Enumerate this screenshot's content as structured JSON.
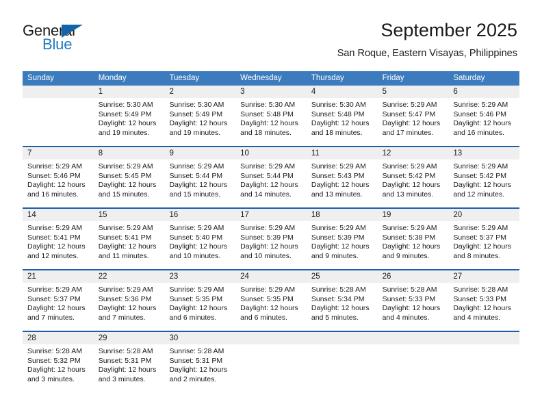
{
  "logo": {
    "text_top": "General",
    "text_bottom": "Blue",
    "accent_color": "#1f78c1",
    "triangle_color": "#1263a8"
  },
  "header": {
    "title": "September 2025",
    "location": "San Roque, Eastern Visayas, Philippines"
  },
  "theme": {
    "header_blue": "#3c7cbe",
    "divider_blue": "#1c5ea8",
    "daynum_band": "#efefef"
  },
  "weekdays": [
    "Sunday",
    "Monday",
    "Tuesday",
    "Wednesday",
    "Thursday",
    "Friday",
    "Saturday"
  ],
  "weeks": [
    {
      "days": [
        {
          "num": "",
          "sunrise": "",
          "sunset": "",
          "daylight_1": "",
          "daylight_2": ""
        },
        {
          "num": "1",
          "sunrise": "Sunrise: 5:30 AM",
          "sunset": "Sunset: 5:49 PM",
          "daylight_1": "Daylight: 12 hours",
          "daylight_2": "and 19 minutes."
        },
        {
          "num": "2",
          "sunrise": "Sunrise: 5:30 AM",
          "sunset": "Sunset: 5:49 PM",
          "daylight_1": "Daylight: 12 hours",
          "daylight_2": "and 19 minutes."
        },
        {
          "num": "3",
          "sunrise": "Sunrise: 5:30 AM",
          "sunset": "Sunset: 5:48 PM",
          "daylight_1": "Daylight: 12 hours",
          "daylight_2": "and 18 minutes."
        },
        {
          "num": "4",
          "sunrise": "Sunrise: 5:30 AM",
          "sunset": "Sunset: 5:48 PM",
          "daylight_1": "Daylight: 12 hours",
          "daylight_2": "and 18 minutes."
        },
        {
          "num": "5",
          "sunrise": "Sunrise: 5:29 AM",
          "sunset": "Sunset: 5:47 PM",
          "daylight_1": "Daylight: 12 hours",
          "daylight_2": "and 17 minutes."
        },
        {
          "num": "6",
          "sunrise": "Sunrise: 5:29 AM",
          "sunset": "Sunset: 5:46 PM",
          "daylight_1": "Daylight: 12 hours",
          "daylight_2": "and 16 minutes."
        }
      ]
    },
    {
      "days": [
        {
          "num": "7",
          "sunrise": "Sunrise: 5:29 AM",
          "sunset": "Sunset: 5:46 PM",
          "daylight_1": "Daylight: 12 hours",
          "daylight_2": "and 16 minutes."
        },
        {
          "num": "8",
          "sunrise": "Sunrise: 5:29 AM",
          "sunset": "Sunset: 5:45 PM",
          "daylight_1": "Daylight: 12 hours",
          "daylight_2": "and 15 minutes."
        },
        {
          "num": "9",
          "sunrise": "Sunrise: 5:29 AM",
          "sunset": "Sunset: 5:44 PM",
          "daylight_1": "Daylight: 12 hours",
          "daylight_2": "and 15 minutes."
        },
        {
          "num": "10",
          "sunrise": "Sunrise: 5:29 AM",
          "sunset": "Sunset: 5:44 PM",
          "daylight_1": "Daylight: 12 hours",
          "daylight_2": "and 14 minutes."
        },
        {
          "num": "11",
          "sunrise": "Sunrise: 5:29 AM",
          "sunset": "Sunset: 5:43 PM",
          "daylight_1": "Daylight: 12 hours",
          "daylight_2": "and 13 minutes."
        },
        {
          "num": "12",
          "sunrise": "Sunrise: 5:29 AM",
          "sunset": "Sunset: 5:42 PM",
          "daylight_1": "Daylight: 12 hours",
          "daylight_2": "and 13 minutes."
        },
        {
          "num": "13",
          "sunrise": "Sunrise: 5:29 AM",
          "sunset": "Sunset: 5:42 PM",
          "daylight_1": "Daylight: 12 hours",
          "daylight_2": "and 12 minutes."
        }
      ]
    },
    {
      "days": [
        {
          "num": "14",
          "sunrise": "Sunrise: 5:29 AM",
          "sunset": "Sunset: 5:41 PM",
          "daylight_1": "Daylight: 12 hours",
          "daylight_2": "and 12 minutes."
        },
        {
          "num": "15",
          "sunrise": "Sunrise: 5:29 AM",
          "sunset": "Sunset: 5:41 PM",
          "daylight_1": "Daylight: 12 hours",
          "daylight_2": "and 11 minutes."
        },
        {
          "num": "16",
          "sunrise": "Sunrise: 5:29 AM",
          "sunset": "Sunset: 5:40 PM",
          "daylight_1": "Daylight: 12 hours",
          "daylight_2": "and 10 minutes."
        },
        {
          "num": "17",
          "sunrise": "Sunrise: 5:29 AM",
          "sunset": "Sunset: 5:39 PM",
          "daylight_1": "Daylight: 12 hours",
          "daylight_2": "and 10 minutes."
        },
        {
          "num": "18",
          "sunrise": "Sunrise: 5:29 AM",
          "sunset": "Sunset: 5:39 PM",
          "daylight_1": "Daylight: 12 hours",
          "daylight_2": "and 9 minutes."
        },
        {
          "num": "19",
          "sunrise": "Sunrise: 5:29 AM",
          "sunset": "Sunset: 5:38 PM",
          "daylight_1": "Daylight: 12 hours",
          "daylight_2": "and 9 minutes."
        },
        {
          "num": "20",
          "sunrise": "Sunrise: 5:29 AM",
          "sunset": "Sunset: 5:37 PM",
          "daylight_1": "Daylight: 12 hours",
          "daylight_2": "and 8 minutes."
        }
      ]
    },
    {
      "days": [
        {
          "num": "21",
          "sunrise": "Sunrise: 5:29 AM",
          "sunset": "Sunset: 5:37 PM",
          "daylight_1": "Daylight: 12 hours",
          "daylight_2": "and 7 minutes."
        },
        {
          "num": "22",
          "sunrise": "Sunrise: 5:29 AM",
          "sunset": "Sunset: 5:36 PM",
          "daylight_1": "Daylight: 12 hours",
          "daylight_2": "and 7 minutes."
        },
        {
          "num": "23",
          "sunrise": "Sunrise: 5:29 AM",
          "sunset": "Sunset: 5:35 PM",
          "daylight_1": "Daylight: 12 hours",
          "daylight_2": "and 6 minutes."
        },
        {
          "num": "24",
          "sunrise": "Sunrise: 5:29 AM",
          "sunset": "Sunset: 5:35 PM",
          "daylight_1": "Daylight: 12 hours",
          "daylight_2": "and 6 minutes."
        },
        {
          "num": "25",
          "sunrise": "Sunrise: 5:28 AM",
          "sunset": "Sunset: 5:34 PM",
          "daylight_1": "Daylight: 12 hours",
          "daylight_2": "and 5 minutes."
        },
        {
          "num": "26",
          "sunrise": "Sunrise: 5:28 AM",
          "sunset": "Sunset: 5:33 PM",
          "daylight_1": "Daylight: 12 hours",
          "daylight_2": "and 4 minutes."
        },
        {
          "num": "27",
          "sunrise": "Sunrise: 5:28 AM",
          "sunset": "Sunset: 5:33 PM",
          "daylight_1": "Daylight: 12 hours",
          "daylight_2": "and 4 minutes."
        }
      ]
    },
    {
      "days": [
        {
          "num": "28",
          "sunrise": "Sunrise: 5:28 AM",
          "sunset": "Sunset: 5:32 PM",
          "daylight_1": "Daylight: 12 hours",
          "daylight_2": "and 3 minutes."
        },
        {
          "num": "29",
          "sunrise": "Sunrise: 5:28 AM",
          "sunset": "Sunset: 5:31 PM",
          "daylight_1": "Daylight: 12 hours",
          "daylight_2": "and 3 minutes."
        },
        {
          "num": "30",
          "sunrise": "Sunrise: 5:28 AM",
          "sunset": "Sunset: 5:31 PM",
          "daylight_1": "Daylight: 12 hours",
          "daylight_2": "and 2 minutes."
        },
        {
          "num": "",
          "sunrise": "",
          "sunset": "",
          "daylight_1": "",
          "daylight_2": ""
        },
        {
          "num": "",
          "sunrise": "",
          "sunset": "",
          "daylight_1": "",
          "daylight_2": ""
        },
        {
          "num": "",
          "sunrise": "",
          "sunset": "",
          "daylight_1": "",
          "daylight_2": ""
        },
        {
          "num": "",
          "sunrise": "",
          "sunset": "",
          "daylight_1": "",
          "daylight_2": ""
        }
      ]
    }
  ]
}
